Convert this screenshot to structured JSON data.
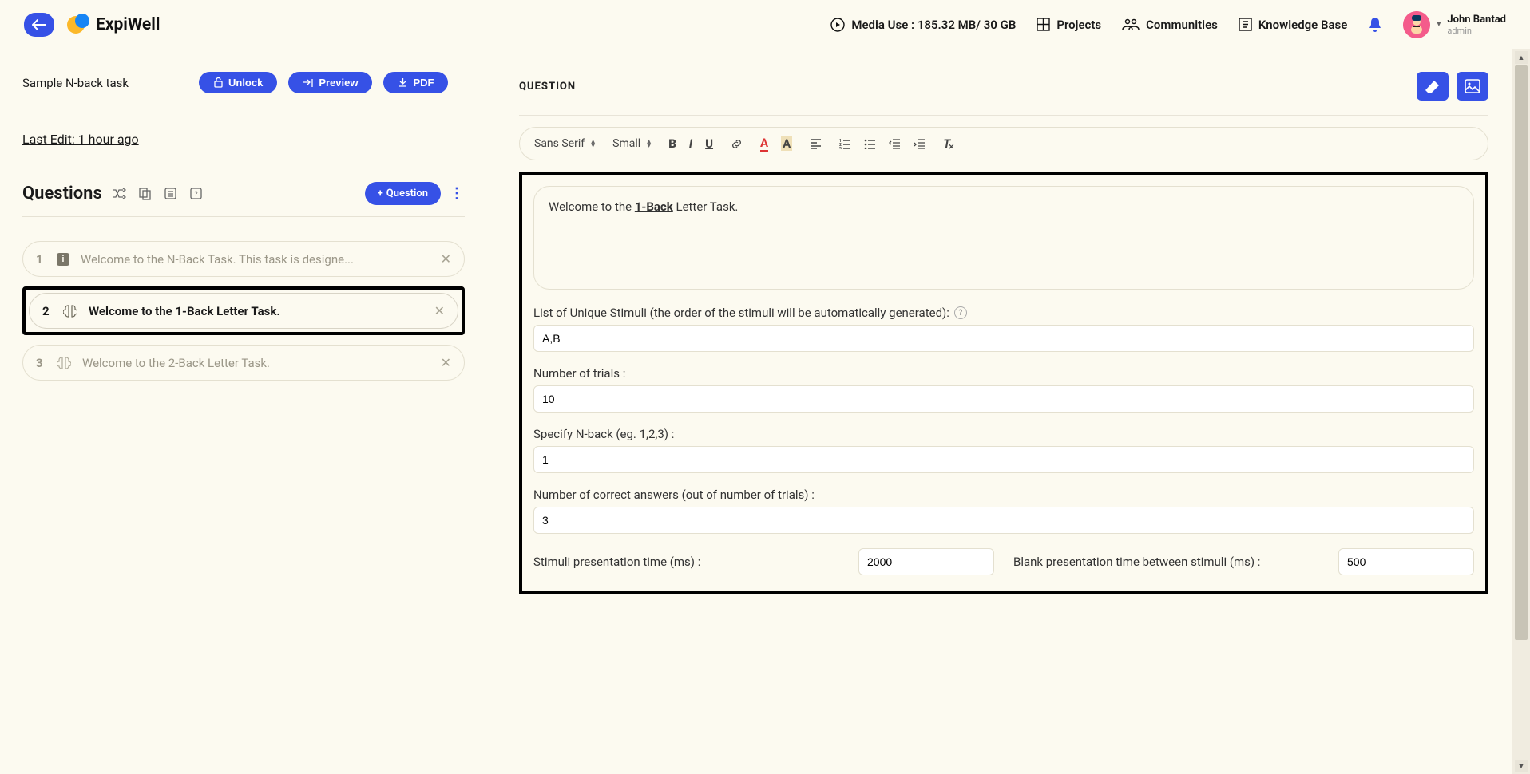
{
  "header": {
    "brand": "ExpiWell",
    "media_use": "Media Use : 185.32 MB/ 30 GB",
    "nav": {
      "projects": "Projects",
      "communities": "Communities",
      "knowledge": "Knowledge Base"
    },
    "user": {
      "name": "John Bantad",
      "role": "admin"
    }
  },
  "left": {
    "task_name": "Sample N-back task",
    "buttons": {
      "unlock": "Unlock",
      "preview": "Preview",
      "pdf": "PDF"
    },
    "last_edit": "Last Edit: 1 hour ago",
    "questions_title": "Questions",
    "add_question": "Question",
    "items": [
      {
        "n": "1",
        "text": "Welcome to the N-Back Task. This task is designe..."
      },
      {
        "n": "2",
        "text": "Welcome to the 1-Back Letter Task."
      },
      {
        "n": "3",
        "text": "Welcome to the 2-Back Letter Task."
      }
    ]
  },
  "right": {
    "title": "QUESTION",
    "toolbar": {
      "font": "Sans Serif",
      "size": "Small"
    },
    "richtext": {
      "pre": "Welcome to the ",
      "bold": "1-Back",
      "post": " Letter Task."
    },
    "fields": {
      "stimuli_label": "List of Unique Stimuli (the order of the stimuli will be automatically generated):",
      "stimuli_value": "A,B",
      "trials_label": "Number of trials :",
      "trials_value": "10",
      "nback_label": "Specify N-back (eg. 1,2,3) :",
      "nback_value": "1",
      "correct_label": "Number of correct answers (out of number of trials) :",
      "correct_value": "3",
      "stim_time_label": "Stimuli presentation time (ms) :",
      "stim_time_value": "2000",
      "blank_time_label": "Blank presentation time between stimuli (ms) :",
      "blank_time_value": "500"
    }
  }
}
